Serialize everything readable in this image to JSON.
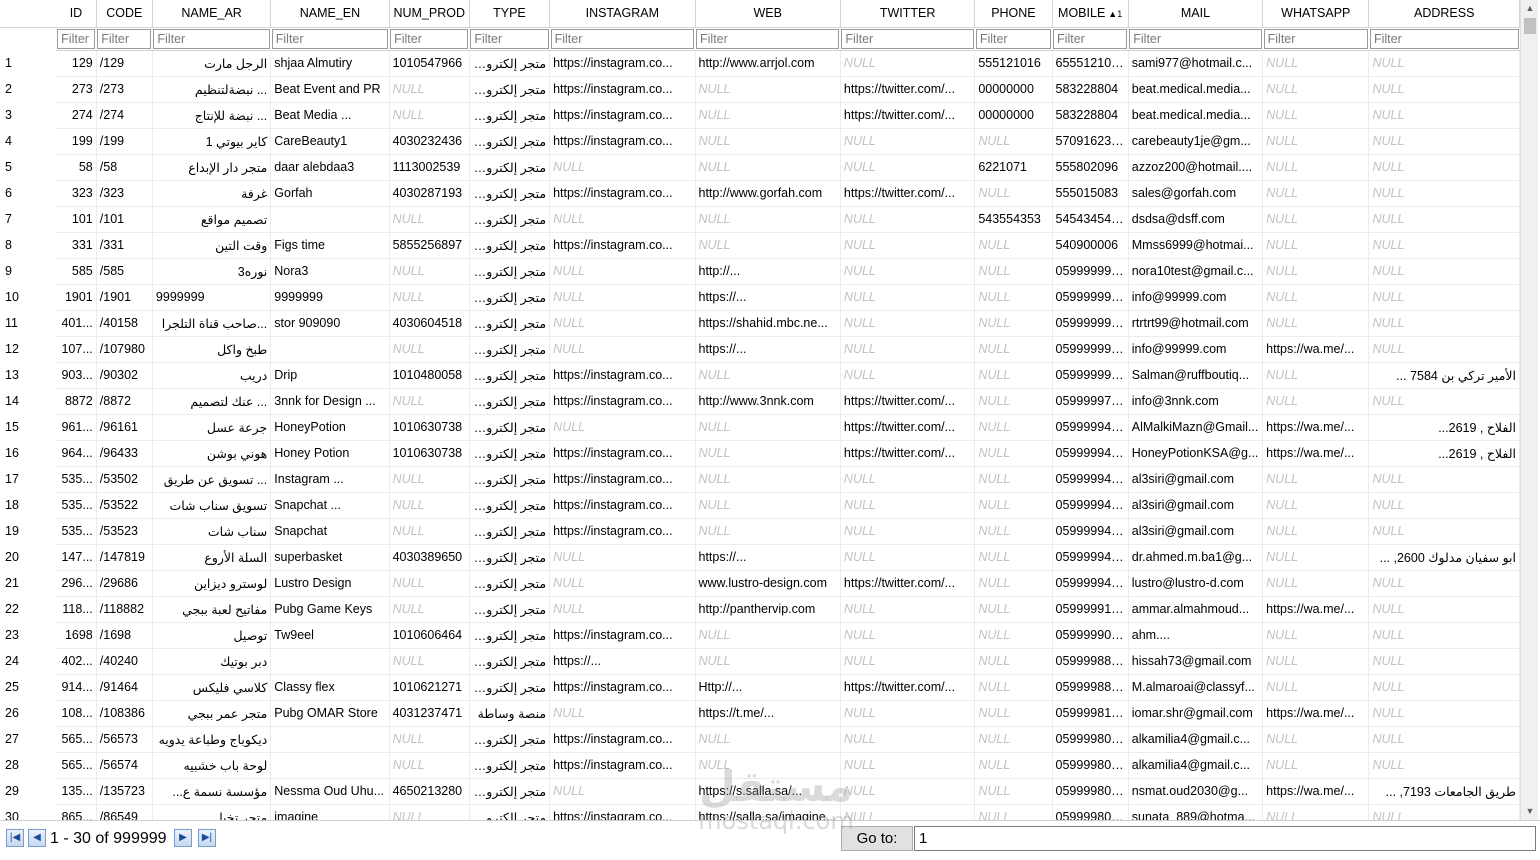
{
  "columns": [
    "ID",
    "CODE",
    "NAME_AR",
    "NAME_EN",
    "NUM_PROD",
    "TYPE",
    "INSTAGRAM",
    "WEB",
    "TWITTER",
    "PHONE",
    "MOBILE",
    "MAIL",
    "WHATSAPP",
    "ADDRESS"
  ],
  "sort": {
    "column": "MOBILE",
    "indicator": "▲1"
  },
  "filter_placeholder": "Filter",
  "null_text": "NULL",
  "rows": [
    [
      "1",
      "129",
      "/129",
      "الرجل مارت",
      "shjaa Almutiry",
      "1010547966",
      "متجر إلكتروني",
      "https://instagram.co...",
      "http://www.arrjol.com",
      null,
      "555121016",
      "6555121016",
      "sami977@hotmail.c...",
      null,
      null
    ],
    [
      "2",
      "273",
      "/273",
      "... نبضةلتنظيم",
      "Beat Event and PR",
      null,
      "متجر إلكتروني",
      "https://instagram.co...",
      null,
      "https://twitter.com/...",
      "00000000",
      "583228804",
      "beat.medical.media...",
      null,
      null
    ],
    [
      "3",
      "274",
      "/274",
      "... نبضة للإنتاج",
      "Beat Media ...",
      null,
      "متجر إلكتروني",
      "https://instagram.co...",
      null,
      "https://twitter.com/...",
      "00000000",
      "583228804",
      "beat.medical.media...",
      null,
      null
    ],
    [
      "4",
      "199",
      "/199",
      "كاير بيوتي 1",
      "CareBeauty1",
      "4030232436",
      "متجر إلكتروني",
      "https://instagram.co...",
      null,
      null,
      null,
      "5709162317",
      "carebeauty1je@gm...",
      null,
      null
    ],
    [
      "5",
      "58",
      "/58",
      "متجر دار الإبداع",
      "daar alebdaa3",
      "1113002539",
      "متجر إلكتروني",
      null,
      null,
      null,
      "6221071",
      "555802096",
      "azzoz200@hotmail....",
      null,
      null
    ],
    [
      "6",
      "323",
      "/323",
      "غرفة",
      "Gorfah",
      "4030287193",
      "متجر إلكتروني",
      "https://instagram.co...",
      "http://www.gorfah.com",
      "https://twitter.com/...",
      null,
      "555015083",
      "sales@gorfah.com",
      null,
      null
    ],
    [
      "7",
      "101",
      "/101",
      "تصميم مواقع",
      "",
      null,
      "متجر إلكتروني",
      null,
      null,
      null,
      "543554353",
      "5454345454",
      "dsdsa@dsff.com",
      null,
      null
    ],
    [
      "8",
      "331",
      "/331",
      "وقت التين",
      "Figs time",
      "5855256897",
      "متجر إلكتروني",
      "https://instagram.co...",
      null,
      null,
      null,
      "540900006",
      "Mmss6999@hotmai...",
      null,
      null
    ],
    [
      "9",
      "585",
      "/585",
      "نوره3",
      "Nora3",
      null,
      "متجر إلكتروني",
      null,
      "http://...",
      null,
      null,
      "0599999999",
      "nora10test@gmail.c...",
      null,
      null
    ],
    [
      "10",
      "1901",
      "/1901",
      "9999999",
      "9999999",
      null,
      "متجر إلكتروني",
      null,
      "https://...",
      null,
      null,
      "0599999999",
      "info@99999.com",
      null,
      null
    ],
    [
      "11",
      "401...",
      "/40158",
      "...صاحب قناة التلجرا",
      "stor 909090",
      "4030604518",
      "متجر إلكتروني",
      null,
      "https://shahid.mbc.ne...",
      null,
      null,
      "0599999999",
      "rtrtrt99@hotmail.com",
      null,
      null
    ],
    [
      "12",
      "107...",
      "/107980",
      "طبخ واكل",
      "",
      null,
      "متجر إلكتروني",
      null,
      "https://...",
      null,
      null,
      "0599999999",
      "info@99999.com",
      "https://wa.me/...",
      null
    ],
    [
      "13",
      "903...",
      "/90302",
      "دريب",
      "Drip",
      "1010480058",
      "متجر إلكتروني",
      "https://instagram.co...",
      null,
      null,
      null,
      "0599999940",
      "Salman@ruffboutiq...",
      null,
      "الأمير تركي بن 7584 ..."
    ],
    [
      "14",
      "8872",
      "/8872",
      "... عنك لتصميم",
      "3nnk for Design ...",
      null,
      "متجر إلكتروني",
      "https://instagram.co...",
      "http://www.3nnk.com",
      "https://twitter.com/...",
      null,
      "0599999770",
      "info@3nnk.com",
      null,
      null
    ],
    [
      "15",
      "961...",
      "/96161",
      "جرعة عسل",
      "HoneyPotion",
      "1010630738",
      "متجر إلكتروني",
      null,
      null,
      "https://twitter.com/...",
      null,
      "0599999479",
      "AlMalkiMazn@Gmail...",
      "https://wa.me/...",
      "الفلاح , 2619..."
    ],
    [
      "16",
      "964...",
      "/96433",
      "هوني بوشن",
      "Honey Potion",
      "1010630738",
      "متجر إلكتروني",
      "https://instagram.co...",
      null,
      "https://twitter.com/...",
      null,
      "0599999479",
      "HoneyPotionKSA@g...",
      "https://wa.me/...",
      "الفلاح , 2619..."
    ],
    [
      "17",
      "535...",
      "/53502",
      "... تسويق عن طريق",
      "Instagram ...",
      null,
      "متجر إلكتروني",
      "https://instagram.co...",
      null,
      null,
      null,
      "0599999462",
      "al3siri@gmail.com",
      null,
      null
    ],
    [
      "18",
      "535...",
      "/53522",
      "تسويق سناب شات",
      "Snapchat ...",
      null,
      "متجر إلكتروني",
      "https://instagram.co...",
      null,
      null,
      null,
      "0599999462",
      "al3siri@gmail.com",
      null,
      null
    ],
    [
      "19",
      "535...",
      "/53523",
      "سناب شات",
      "Snapchat",
      null,
      "متجر إلكتروني",
      "https://instagram.co...",
      null,
      null,
      null,
      "0599999462",
      "al3siri@gmail.com",
      null,
      null
    ],
    [
      "20",
      "147...",
      "/147819",
      "السلة الأروع",
      "superbasket",
      "4030389650",
      "متجر إلكتروني",
      null,
      "https://...",
      null,
      null,
      "0599999442",
      "dr.ahmed.m.ba1@g...",
      null,
      "ابو سفيان مدلوك 2600, ..."
    ],
    [
      "21",
      "296...",
      "/29686",
      "لوسترو ديزاين",
      "Lustro Design",
      null,
      "متجر إلكتروني",
      null,
      "www.lustro-design.com",
      "https://twitter.com/...",
      null,
      "0599999416",
      "lustro@lustro-d.com",
      null,
      null
    ],
    [
      "22",
      "118...",
      "/118882",
      "مفاتيح لعبة ببجي",
      "Pubg Game Keys",
      null,
      "متجر إلكتروني",
      null,
      "http://panthervip.com",
      null,
      null,
      "0599999143",
      "ammar.almahmoud...",
      "https://wa.me/...",
      null
    ],
    [
      "23",
      "1698",
      "/1698",
      "توصيل",
      "Tw9eel",
      "1010606464",
      "متجر إلكتروني",
      "https://instagram.co...",
      null,
      null,
      null,
      "0599999066",
      "ahm....",
      null,
      null
    ],
    [
      "24",
      "402...",
      "/40240",
      "دبر بوتيك",
      "",
      null,
      "متجر إلكتروني",
      "https://...",
      null,
      null,
      null,
      "0599998833",
      "hissah73@gmail.com",
      null,
      null
    ],
    [
      "25",
      "914...",
      "/91464",
      "كلاسي فليكس",
      "Classy flex",
      "1010621271",
      "متجر إلكتروني",
      "https://instagram.co...",
      "Http://...",
      "https://twitter.com/...",
      null,
      "0599998807",
      "M.almaroai@classyf...",
      null,
      null
    ],
    [
      "26",
      "108...",
      "/108386",
      "متجر عمر ببجي",
      "Pubg OMAR Store",
      "4031237471",
      "منصة وساطة",
      null,
      "https://t.me/...",
      null,
      null,
      "0599998106",
      "iomar.shr@gmail.com",
      "https://wa.me/...",
      null
    ],
    [
      "27",
      "565...",
      "/56573",
      "ديكوباج وطباعة يدويه",
      "",
      null,
      "متجر إلكتروني",
      "https://instagram.co...",
      null,
      null,
      null,
      "0599998085",
      "alkamilia4@gmail.c...",
      null,
      null
    ],
    [
      "28",
      "565...",
      "/56574",
      "لوحة باب خشبيه",
      "",
      null,
      "متجر إلكتروني",
      "https://instagram.co...",
      null,
      null,
      null,
      "0599998085",
      "alkamilia4@gmail.c...",
      null,
      null
    ],
    [
      "29",
      "135...",
      "/135723",
      "مؤسسة نسمة ع...",
      "Nessma Oud Uhu...",
      "4650213280",
      "متجر إلكتروني",
      null,
      "https://s.salla.sa/...",
      null,
      null,
      "0599998069",
      "nsmat.oud2030@g...",
      "https://wa.me/...",
      "طريق الجامعات 7193, ..."
    ],
    [
      "30",
      "865...",
      "/86549",
      "متجر تخيل",
      "imagine",
      null,
      "متجر إلكتروني",
      "https://instagram.co...",
      "https://salla.sa/imagine...",
      null,
      null,
      "0599998068",
      "sunata_889@hotma...",
      null,
      null
    ]
  ],
  "pager": {
    "first_icon": "first-page-icon",
    "prev_icon": "prev-page-icon",
    "next_icon": "next-page-icon",
    "last_icon": "last-page-icon",
    "range_text": "1 - 30 of 999999",
    "goto_label": "Go to:",
    "goto_value": "1"
  },
  "watermark": {
    "arabic": "مستقل",
    "latin": "mostaql.com"
  }
}
